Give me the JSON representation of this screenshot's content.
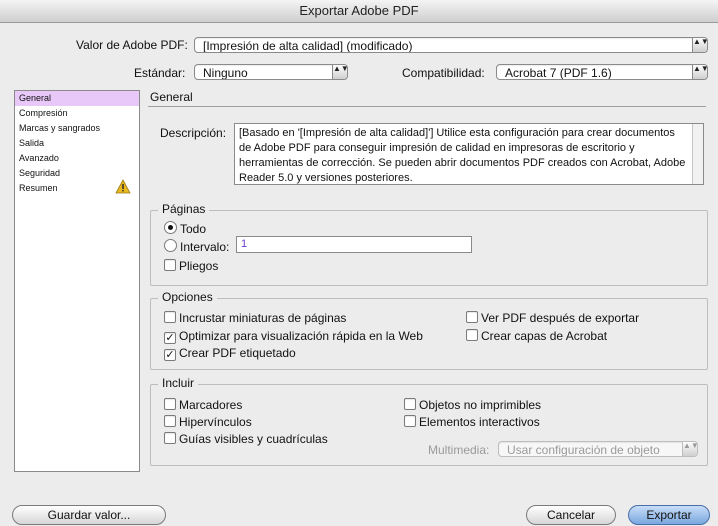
{
  "window": {
    "title": "Exportar Adobe PDF"
  },
  "preset": {
    "label": "Valor de Adobe PDF:",
    "value": "[Impresión de alta calidad] (modificado)"
  },
  "standard": {
    "label": "Estándar:",
    "value": "Ninguno"
  },
  "compatibility": {
    "label": "Compatibilidad:",
    "value": "Acrobat 7 (PDF 1.6)"
  },
  "sidebar": {
    "items": [
      {
        "label": "General",
        "active": true
      },
      {
        "label": "Compresión"
      },
      {
        "label": "Marcas y sangrados"
      },
      {
        "label": "Salida"
      },
      {
        "label": "Avanzado"
      },
      {
        "label": "Seguridad"
      },
      {
        "label": "Resumen",
        "warning": true
      }
    ]
  },
  "general": {
    "title": "General",
    "description_label": "Descripción:",
    "description": "[Basado en '[Impresión de alta calidad]'] Utilice esta configuración para crear documentos de Adobe PDF para conseguir impresión de calidad en impresoras de escritorio y herramientas de corrección. Se pueden abrir documentos PDF creados con Acrobat, Adobe Reader 5.0 y versiones posteriores."
  },
  "pages": {
    "title": "Páginas",
    "all_label": "Todo",
    "range_label": "Intervalo:",
    "range_value": "1",
    "spreads_label": "Pliegos"
  },
  "options": {
    "title": "Opciones",
    "embed_thumbnails": "Incrustar miniaturas de páginas",
    "optimize_web": "Optimizar para visualización rápida en la Web",
    "create_tagged": "Crear PDF etiquetado",
    "view_after": "Ver PDF después de exportar",
    "create_layers": "Crear capas de Acrobat",
    "check_mark": "✓"
  },
  "include": {
    "title": "Incluir",
    "bookmarks": "Marcadores",
    "hyperlinks": "Hipervínculos",
    "guides": "Guías visibles y cuadrículas",
    "nonprinting": "Objetos no imprimibles",
    "interactive": "Elementos interactivos",
    "multimedia_label": "Multimedia:",
    "multimedia_value": "Usar configuración de objeto"
  },
  "buttons": {
    "save_preset": "Guardar valor...",
    "cancel": "Cancelar",
    "export": "Exportar"
  },
  "stepper_glyph": "▲▼",
  "colors": {
    "sidebar_active": "#e8c8f8",
    "default_button": "#7aa7e0",
    "warning": "#e8b820"
  }
}
